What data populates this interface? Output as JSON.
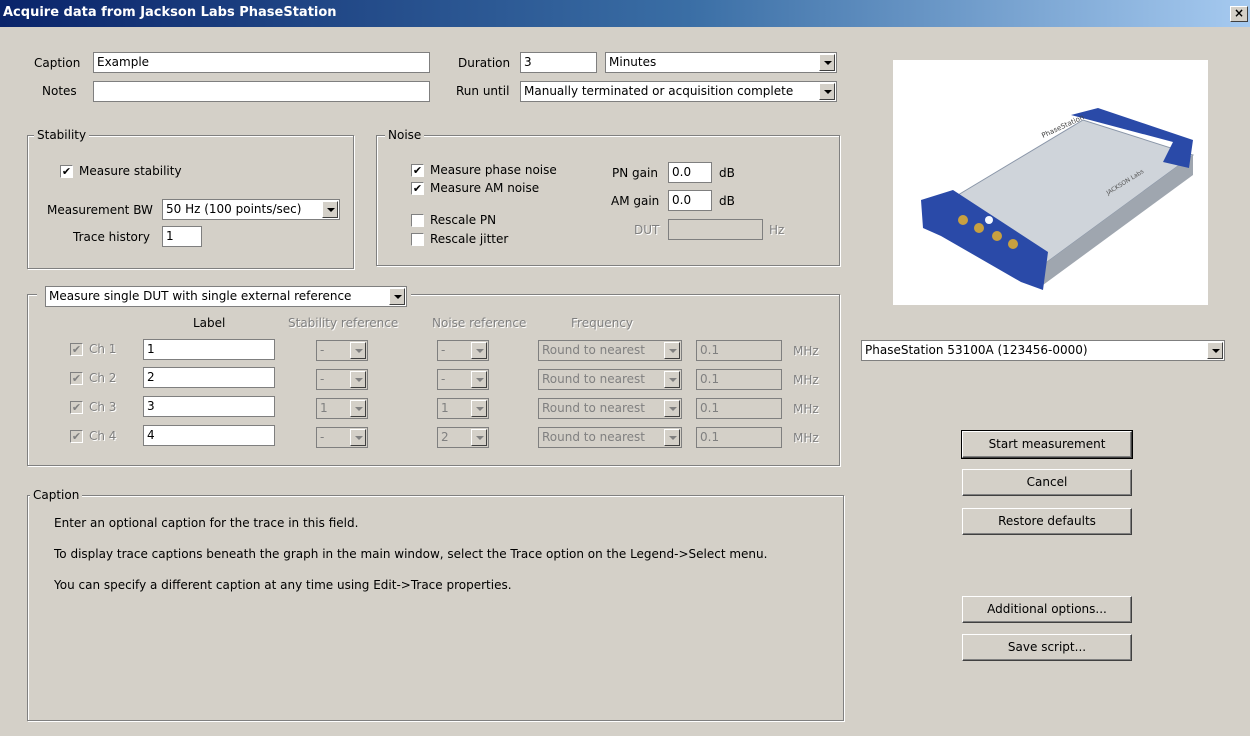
{
  "window": {
    "title": "Acquire data from Jackson Labs PhaseStation",
    "close": "×"
  },
  "top": {
    "caption_label": "Caption",
    "caption_value": "Example",
    "notes_label": "Notes",
    "notes_value": "",
    "duration_label": "Duration",
    "duration_value": "3",
    "duration_unit": "Minutes",
    "rununtil_label": "Run until",
    "rununtil_value": "Manually terminated or acquisition complete"
  },
  "stability": {
    "title": "Stability",
    "measure_label": "Measure stability",
    "measure_checked": "✔",
    "bw_label": "Measurement BW",
    "bw_value": "50 Hz (100 points/sec)",
    "history_label": "Trace history",
    "history_value": "1"
  },
  "noise": {
    "title": "Noise",
    "phase_label": "Measure phase noise",
    "phase_checked": "✔",
    "am_label": "Measure AM noise",
    "am_checked": "✔",
    "rescale_pn_label": "Rescale PN",
    "rescale_jitter_label": "Rescale jitter",
    "pn_gain_label": "PN gain",
    "pn_gain_value": "0.0",
    "pn_gain_unit": "dB",
    "am_gain_label": "AM gain",
    "am_gain_value": "0.0",
    "am_gain_unit": "dB",
    "dut_label": "DUT",
    "dut_value": "",
    "dut_unit": "Hz"
  },
  "channels": {
    "mode": "Measure single DUT with single external reference",
    "headers": {
      "label": "Label",
      "stability_ref": "Stability reference",
      "noise_ref": "Noise reference",
      "frequency": "Frequency"
    },
    "rows": [
      {
        "check": "✔",
        "name": "Ch 1",
        "label": "1",
        "stab_ref": "-",
        "noise_ref": "-",
        "freq_mode": "Round to nearest",
        "freq": "0.1",
        "unit": "MHz"
      },
      {
        "check": "✔",
        "name": "Ch 2",
        "label": "2",
        "stab_ref": "-",
        "noise_ref": "-",
        "freq_mode": "Round to nearest",
        "freq": "0.1",
        "unit": "MHz"
      },
      {
        "check": "✔",
        "name": "Ch 3",
        "label": "3",
        "stab_ref": "1",
        "noise_ref": "1",
        "freq_mode": "Round to nearest",
        "freq": "0.1",
        "unit": "MHz"
      },
      {
        "check": "✔",
        "name": "Ch 4",
        "label": "4",
        "stab_ref": "-",
        "noise_ref": "2",
        "freq_mode": "Round to nearest",
        "freq": "0.1",
        "unit": "MHz"
      }
    ]
  },
  "help": {
    "title": "Caption",
    "line1": "Enter an optional caption for the trace in this field.",
    "line2": "To display trace captions beneath the graph in the main window, select the Trace option on the Legend->Select menu.",
    "line3": "You can specify a different caption at any time using Edit->Trace properties."
  },
  "device": {
    "selected": "PhaseStation 53100A (123456-0000)",
    "photo_text_brand": "PhaseStation",
    "photo_text_maker": "JACKSON Labs"
  },
  "buttons": {
    "start": "Start measurement",
    "cancel": "Cancel",
    "restore": "Restore defaults",
    "additional": "Additional options...",
    "save_script": "Save script..."
  }
}
